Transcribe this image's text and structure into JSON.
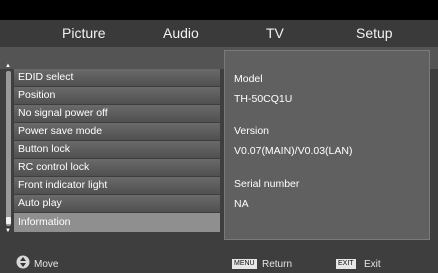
{
  "tabs": [
    "Picture",
    "Audio",
    "TV",
    "Setup"
  ],
  "menu": {
    "items": [
      "EDID select",
      "Position",
      "No signal power off",
      "Power save mode",
      "Button lock",
      "RC control lock",
      "Front indicator light",
      "Auto play",
      "Information"
    ],
    "selected_index": 8
  },
  "info_panel": {
    "model_label": "Model",
    "model_value": "TH-50CQ1U",
    "version_label": "Version",
    "version_value": "V0.07(MAIN)/V0.03(LAN)",
    "serial_label": "Serial number",
    "serial_value": "NA"
  },
  "footer": {
    "move_label": "Move",
    "menu_key": "MENU",
    "return_label": "Return",
    "exit_key": "EXIT",
    "exit_label": "Exit"
  },
  "icons": [
    "move-icon",
    "scroll-up-icon",
    "scroll-down-icon"
  ],
  "colors": {
    "background": "#3e3e3e",
    "selected": "#8f8f8f",
    "panel": "#606060"
  }
}
